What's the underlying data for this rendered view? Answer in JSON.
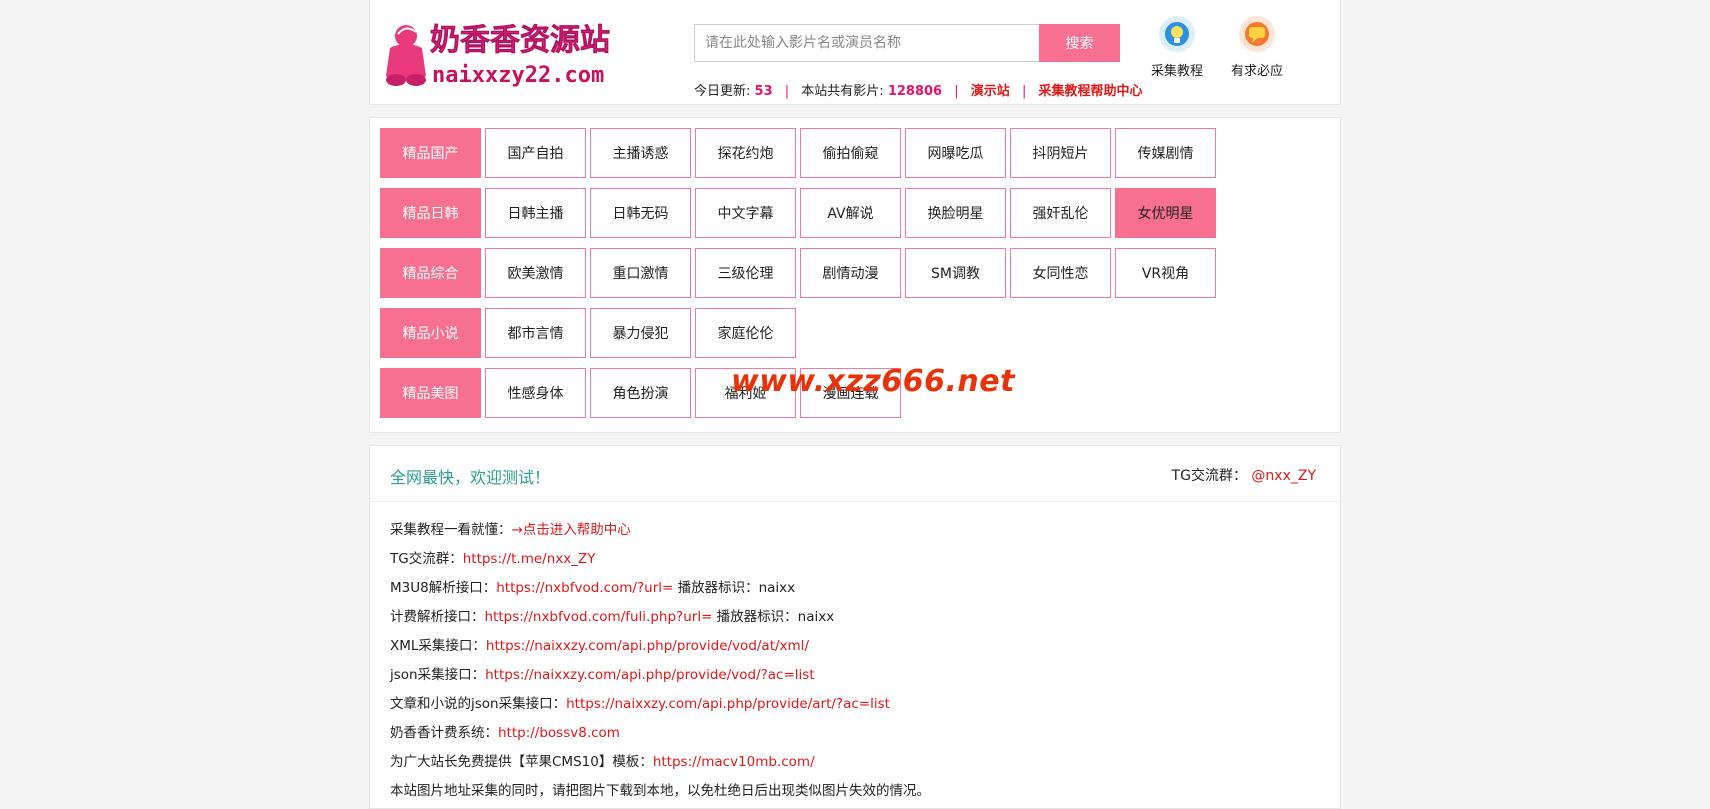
{
  "header": {
    "logo_title": "奶香香资源站",
    "logo_domain": "naixxzy22.com",
    "search_placeholder": "请在此处输入影片名或演员名称",
    "search_button": "搜索",
    "stats": {
      "today_label": "今日更新:",
      "today_value": "53",
      "total_label": "本站共有影片:",
      "total_value": "128806",
      "demo_link": "演示站",
      "help_link": "采集教程帮助中心",
      "separator": "|"
    },
    "quick_links": [
      {
        "label": "采集教程",
        "icon": "lightbulb-icon"
      },
      {
        "label": "有求必应",
        "icon": "chat-bubble-icon"
      }
    ]
  },
  "nav": {
    "rows": [
      {
        "head": "精品国产",
        "items": [
          "国产自拍",
          "主播诱惑",
          "探花约炮",
          "偷拍偷窥",
          "网曝吃瓜",
          "抖阴短片",
          "传媒剧情"
        ]
      },
      {
        "head": "精品日韩",
        "items": [
          "日韩主播",
          "日韩无码",
          "中文字幕",
          "AV解说",
          "换脸明星",
          "强奸乱伦",
          "女优明星"
        ],
        "active_index": 6
      },
      {
        "head": "精品综合",
        "items": [
          "欧美激情",
          "重口激情",
          "三级伦理",
          "剧情动漫",
          "SM调教",
          "女同性恋",
          "VR视角"
        ]
      },
      {
        "head": "精品小说",
        "items": [
          "都市言情",
          "暴力侵犯",
          "家庭伦伦"
        ]
      },
      {
        "head": "精品美图",
        "items": [
          "性感身体",
          "角色扮演",
          "福利姬",
          "漫画连载"
        ]
      }
    ],
    "watermark": "www.xzz666.net",
    "accent_color": "#f7708f"
  },
  "info": {
    "welcome": "全网最快，欢迎测试！",
    "tg_label": "TG交流群：",
    "tg_value": "@nxx_ZY",
    "lines": [
      {
        "label": "采集教程一看就懂：",
        "value": "→点击进入帮助中心",
        "suffix": ""
      },
      {
        "label": "TG交流群：",
        "value": "https://t.me/nxx_ZY",
        "suffix": ""
      },
      {
        "label": "M3U8解析接口：",
        "value": "https://nxbfvod.com/?url=",
        "suffix": " 播放器标识：naixx"
      },
      {
        "label": "计费解析接口：",
        "value": "https://nxbfvod.com/fuli.php?url=",
        "suffix": " 播放器标识：naixx"
      },
      {
        "label": "XML采集接口：",
        "value": "https://naixxzy.com/api.php/provide/vod/at/xml/",
        "suffix": ""
      },
      {
        "label": "json采集接口：",
        "value": "https://naixxzy.com/api.php/provide/vod/?ac=list",
        "suffix": ""
      },
      {
        "label": "文章和小说的json采集接口：",
        "value": "https://naixxzy.com/api.php/provide/art/?ac=list",
        "suffix": ""
      },
      {
        "label": "奶香香计费系统：",
        "value": "http://bossv8.com",
        "suffix": ""
      },
      {
        "label": "为广大站长免费提供【苹果CMS10】模板：",
        "value": "https://macv10mb.com/",
        "suffix": ""
      },
      {
        "label": "本站图片地址采集的同时，请把图片下载到本地，以免杜绝日后出现类似图片失效的情况。",
        "value": "",
        "suffix": ""
      }
    ]
  }
}
